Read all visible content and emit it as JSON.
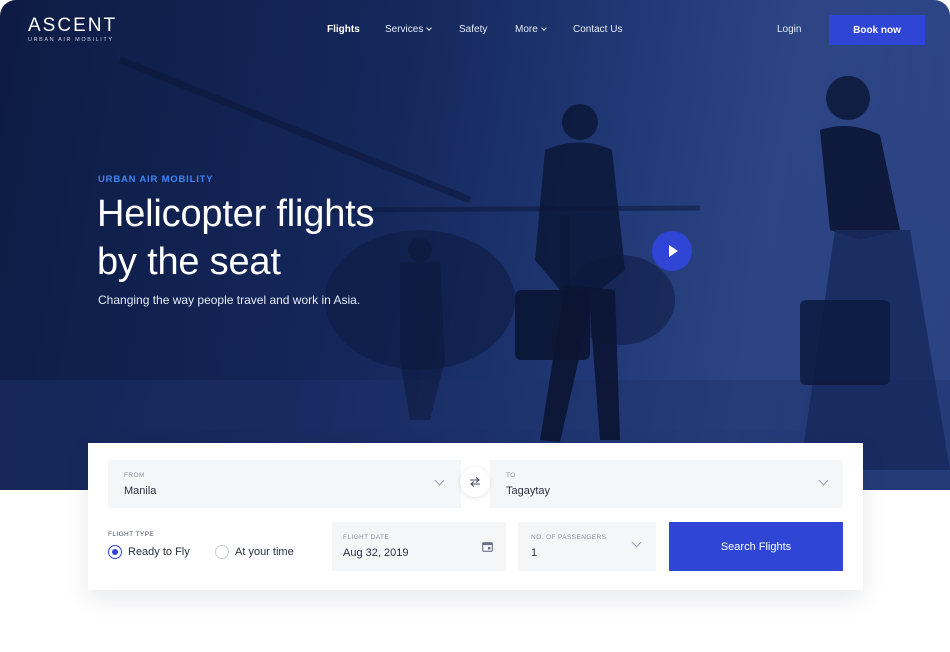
{
  "brand": {
    "name": "ASCENT",
    "tagline": "URBAN AIR MOBILITY"
  },
  "nav": {
    "items": [
      {
        "label": "Flights",
        "active": true,
        "dropdown": false
      },
      {
        "label": "Services",
        "active": false,
        "dropdown": true
      },
      {
        "label": "Safety",
        "active": false,
        "dropdown": false
      },
      {
        "label": "More",
        "active": false,
        "dropdown": true
      },
      {
        "label": "Contact Us",
        "active": false,
        "dropdown": false
      }
    ],
    "login": "Login",
    "cta": "Book now"
  },
  "hero": {
    "eyebrow": "URBAN AIR MOBILITY",
    "headline_line1": "Helicopter flights",
    "headline_line2": "by the seat",
    "subtitle": "Changing the way people travel and work in Asia.",
    "play_icon": "play-icon"
  },
  "search": {
    "from": {
      "label": "FROM",
      "value": "Manila"
    },
    "to": {
      "label": "TO",
      "value": "Tagaytay"
    },
    "swap_icon": "swap-arrows-icon",
    "flight_type": {
      "label": "FLIGHT TYPE",
      "options": [
        {
          "label": "Ready to Fly",
          "selected": true
        },
        {
          "label": "At your time",
          "selected": false
        }
      ]
    },
    "flight_date": {
      "label": "FLIGHT DATE",
      "value": "Aug 32, 2019",
      "icon": "calendar-icon"
    },
    "passengers": {
      "label": "NO. OF PASSENGERS",
      "value": "1"
    },
    "submit": "Search Flights"
  },
  "colors": {
    "accent": "#2f45d6",
    "hero_bg": "#13265a",
    "eyebrow": "#3f86f0",
    "field_bg": "#f5f6f8"
  }
}
